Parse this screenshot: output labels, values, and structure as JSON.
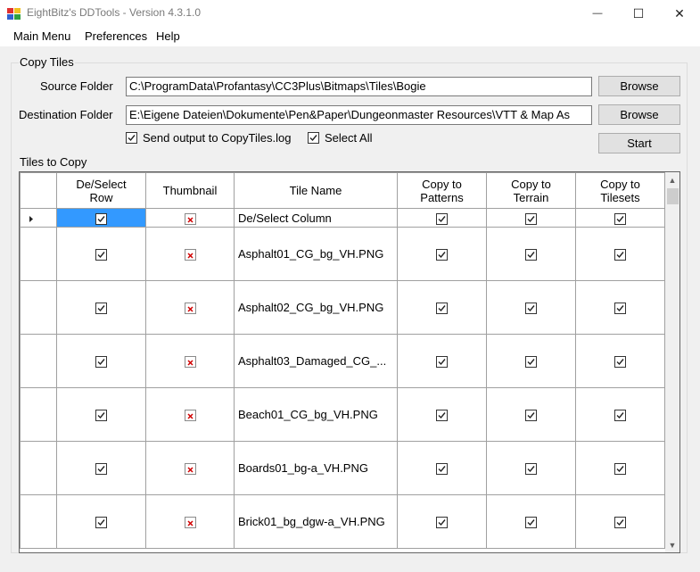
{
  "window": {
    "title": "EightBitz's DDTools - Version 4.3.1.0",
    "minimize_glyph": "—",
    "maximize_glyph": "☐",
    "close_glyph": "✕"
  },
  "menu": {
    "items": [
      "Main Menu",
      "Preferences",
      "Help"
    ]
  },
  "copy_tiles": {
    "group_label": "Copy Tiles",
    "source_label": "Source Folder",
    "source_value": "C:\\ProgramData\\Profantasy\\CC3Plus\\Bitmaps\\Tiles\\Bogie",
    "destination_label": "Destination Folder",
    "destination_value": "E:\\Eigene Dateien\\Dokumente\\Pen&Paper\\Dungeonmaster Resources\\VTT & Map As",
    "browse_label": "Browse",
    "start_label": "Start",
    "send_output_label": "Send output to CopyTiles.log",
    "select_all_label": "Select All",
    "send_output_checked": true,
    "select_all_checked": true
  },
  "tiles": {
    "label": "Tiles to Copy",
    "columns": {
      "select_row": "De/Select Row",
      "thumbnail": "Thumbnail",
      "tile_name": "Tile Name",
      "copy_patterns": "Copy to Patterns",
      "copy_terrain": "Copy to Terrain",
      "copy_tilesets": "Copy to Tilesets"
    },
    "select_column_row": "De/Select Column",
    "rows": [
      {
        "name": "Asphalt01_CG_bg_VH.PNG"
      },
      {
        "name": "Asphalt02_CG_bg_VH.PNG"
      },
      {
        "name": "Asphalt03_Damaged_CG_..."
      },
      {
        "name": "Beach01_CG_bg_VH.PNG"
      },
      {
        "name": "Boards01_bg-a_VH.PNG"
      },
      {
        "name": "Brick01_bg_dgw-a_VH.PNG"
      }
    ]
  },
  "icons": {
    "app": "ddtools-app-icon",
    "checkbox": "checkbox-checked-icon",
    "thumbnail_missing": "broken-image-icon",
    "row_pointer": "row-pointer-icon"
  },
  "colors": {
    "selection": "#3399ff",
    "error_mark": "#d00000"
  }
}
